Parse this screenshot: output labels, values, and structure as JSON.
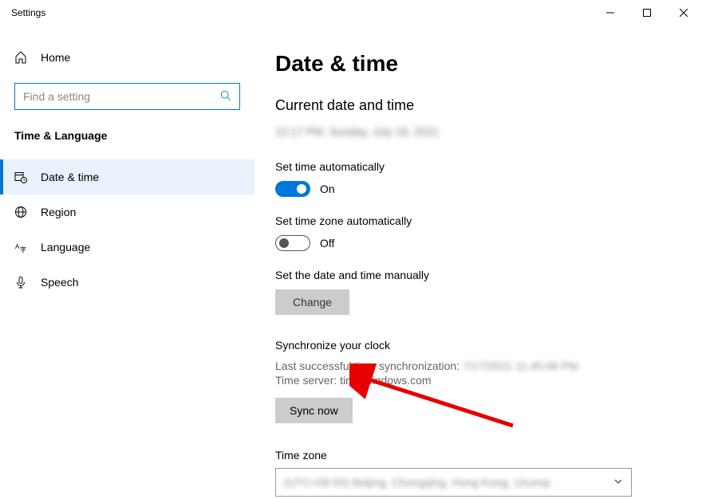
{
  "titleBar": {
    "title": "Settings"
  },
  "sidebar": {
    "homeLabel": "Home",
    "searchPlaceholder": "Find a setting",
    "groupTitle": "Time & Language",
    "items": [
      {
        "label": "Date & time"
      },
      {
        "label": "Region"
      },
      {
        "label": "Language"
      },
      {
        "label": "Speech"
      }
    ]
  },
  "page": {
    "title": "Date & time",
    "currentHeading": "Current date and time",
    "currentValue": "12:17 PM, Sunday, July 18, 2021",
    "setTimeAuto": {
      "label": "Set time automatically",
      "state": "On"
    },
    "setTzAuto": {
      "label": "Set time zone automatically",
      "state": "Off"
    },
    "setManual": {
      "label": "Set the date and time manually",
      "button": "Change"
    },
    "sync": {
      "heading": "Synchronize your clock",
      "lastLabel": "Last successful time synchronization:",
      "lastValue": "7/17/2021 11:45:06 PM",
      "serverLabel": "Time server:",
      "serverValue": "time.windows.com",
      "button": "Sync now"
    },
    "timezone": {
      "label": "Time zone",
      "value": "(UTC+08:00) Beijing, Chongqing, Hong Kong, Urumqi"
    }
  }
}
